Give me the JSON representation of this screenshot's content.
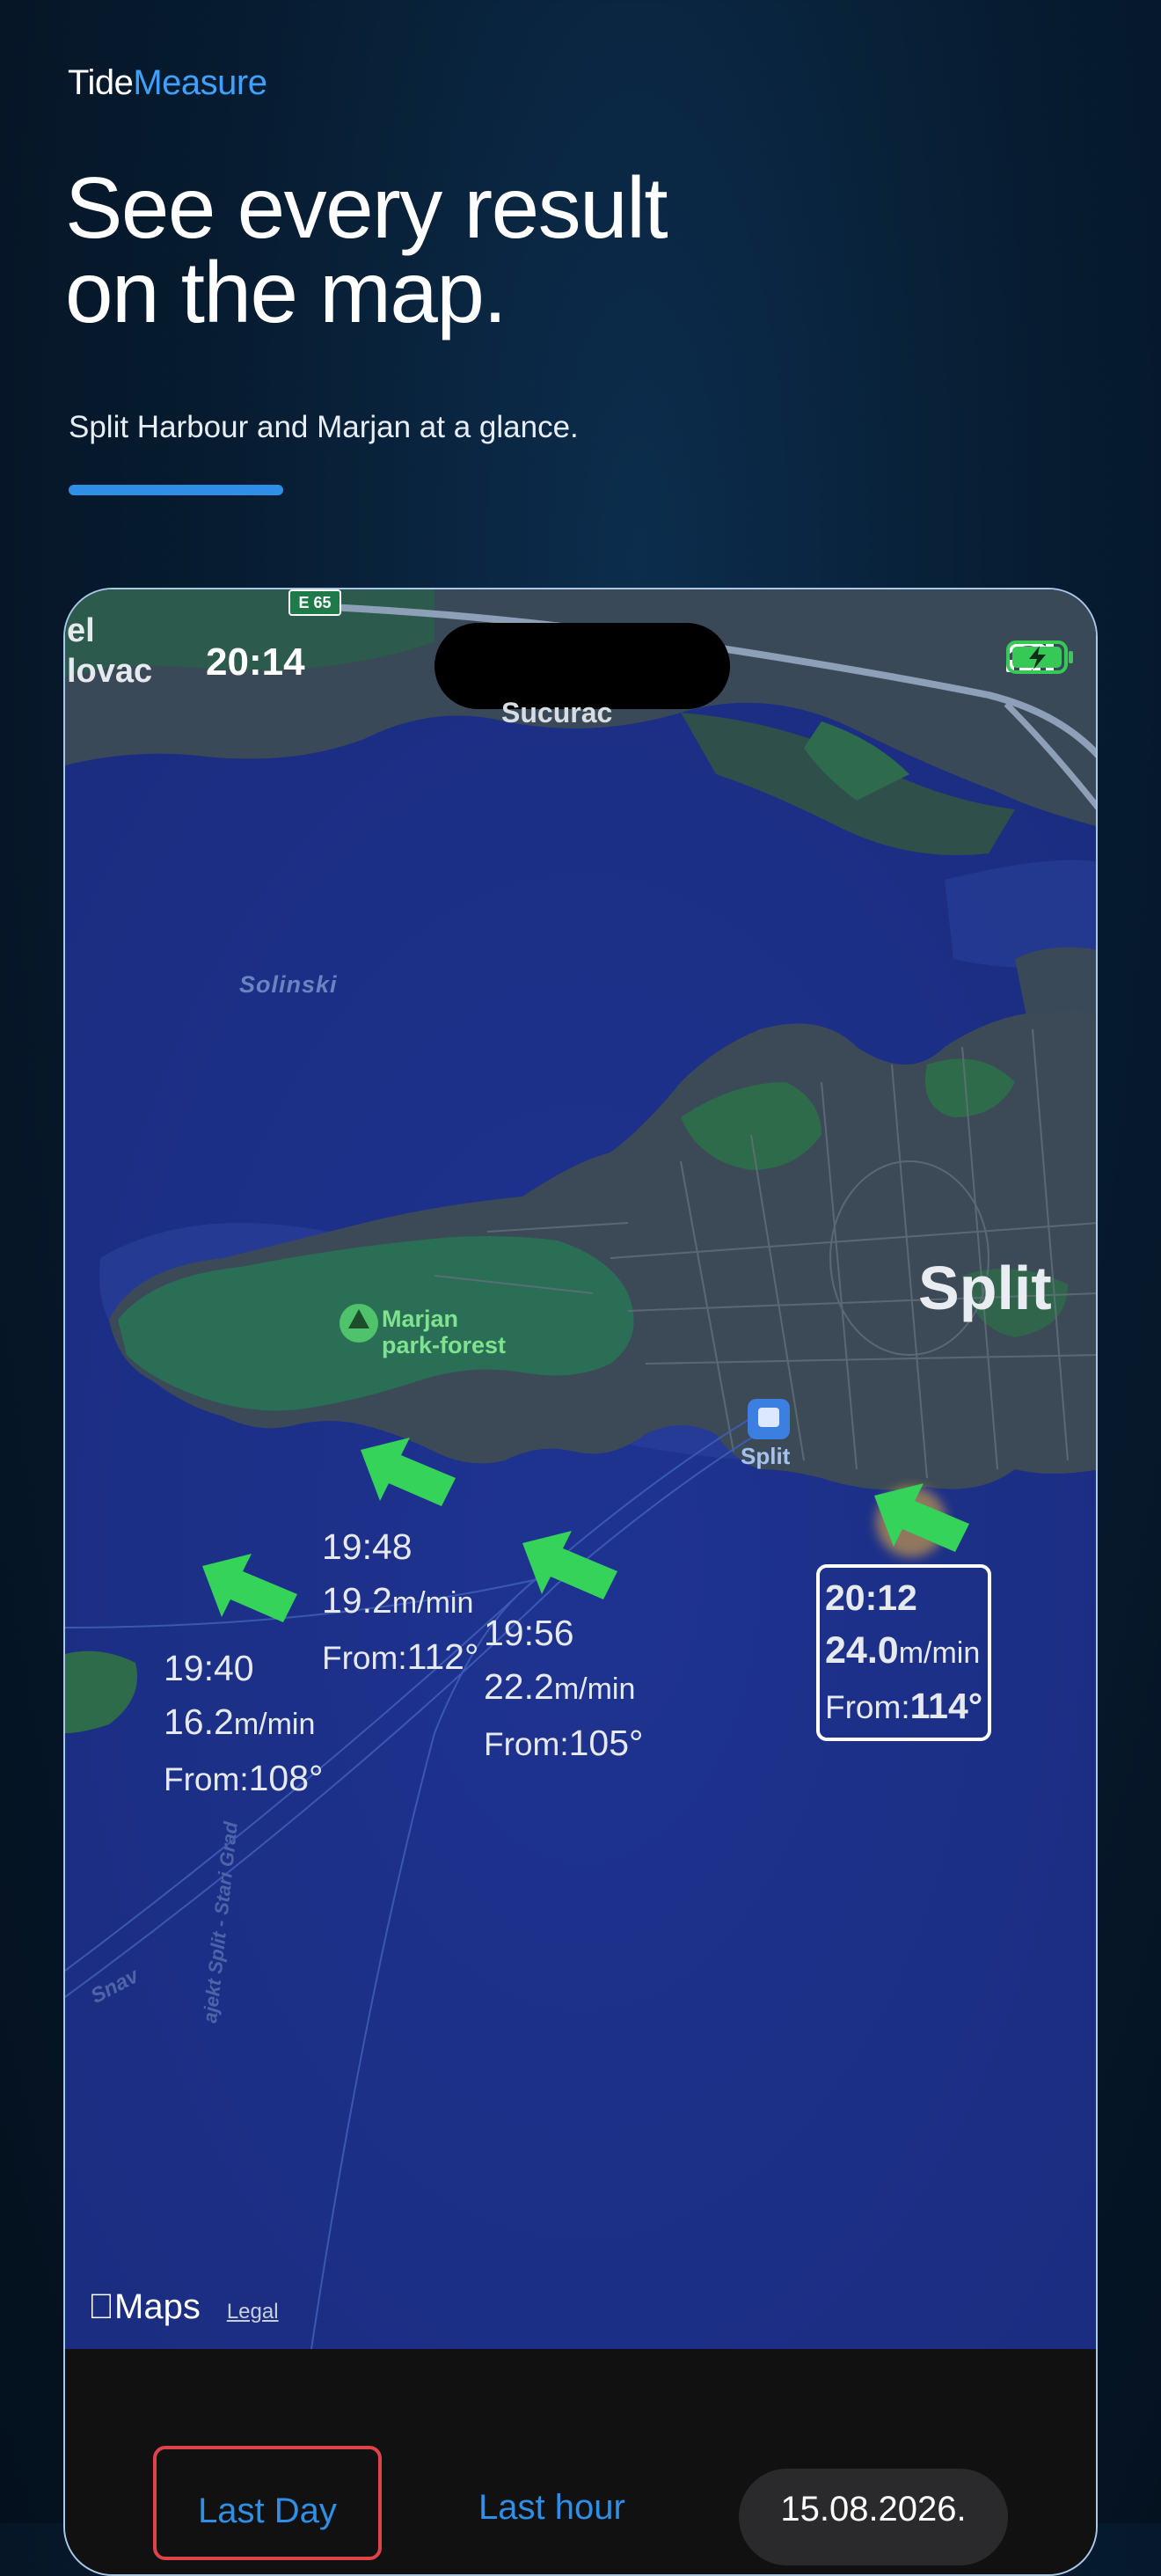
{
  "brand": {
    "part1": "Tide",
    "part2": "Measure"
  },
  "headline": {
    "line1": "See every result",
    "line2": "on the map."
  },
  "subheadline": "Split Harbour and Marjan at a glance.",
  "colors": {
    "accent": "#2f8fe6",
    "brand_accent": "#3fa1ff",
    "arrow": "#35d35a",
    "selected_outline": "#e0424a"
  },
  "status_bar": {
    "time": "20:14",
    "icons": [
      "cellular-signal-icon",
      "wifi-icon",
      "battery-charging-icon"
    ]
  },
  "map": {
    "labels": {
      "place_top_left_line1": "el",
      "place_top_left_line2": "lovac",
      "sucurac": "Sucurac",
      "solinski": "Solinski",
      "city": "Split",
      "park_line1": "Marjan",
      "park_line2": "park-forest",
      "station": "Split",
      "snav": "Snav",
      "ferry": "ajekt Split - Stari Grad",
      "highway": "E 65"
    },
    "readings": [
      {
        "time": "19:40",
        "speed": "16.2",
        "unit": "m/min",
        "from_label": "From:",
        "direction": "108°"
      },
      {
        "time": "19:48",
        "speed": "19.2",
        "unit": "m/min",
        "from_label": "From:",
        "direction": "112°"
      },
      {
        "time": "19:56",
        "speed": "22.2",
        "unit": "m/min",
        "from_label": "From:",
        "direction": "105°"
      },
      {
        "time": "20:12",
        "speed": "24.0",
        "unit": "m/min",
        "from_label": "From:",
        "direction": "114°"
      }
    ],
    "attribution": {
      "maps": "Maps",
      "legal": "Legal"
    }
  },
  "filters": {
    "last_day": "Last Day",
    "last_hour": "Last hour",
    "date": "15.08.2026."
  }
}
